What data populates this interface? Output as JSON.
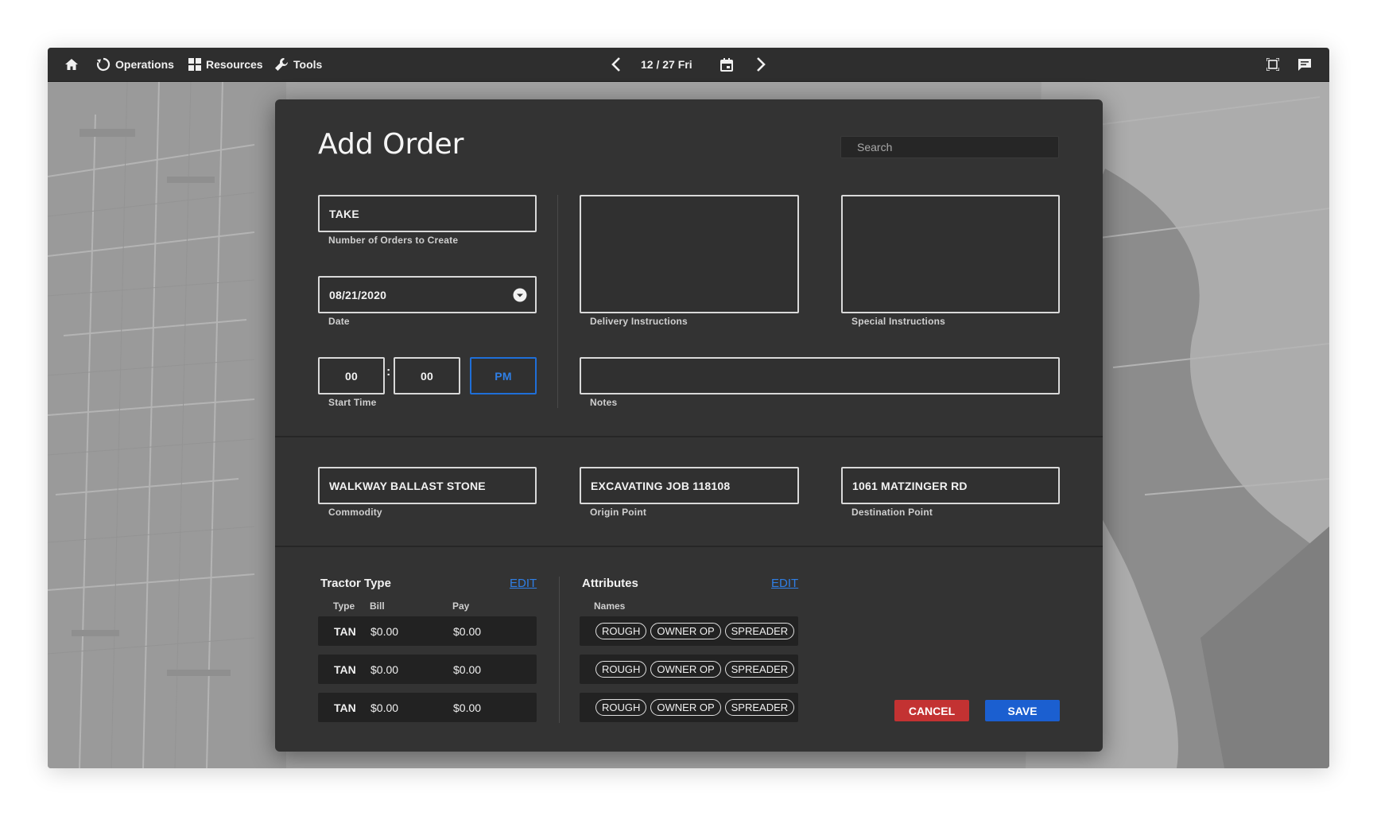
{
  "topbar": {
    "home_icon": "home-icon",
    "operations_label": "Operations",
    "resources_label": "Resources",
    "tools_label": "Tools",
    "date_display": "12 / 27 Fri"
  },
  "dialog": {
    "title": "Add Order",
    "search_placeholder": "Search",
    "orders_to_create": {
      "value": "TAKE",
      "label": "Number of Orders to Create"
    },
    "date": {
      "value": "08/21/2020",
      "label": "Date"
    },
    "start_time": {
      "hour": "00",
      "minute": "00",
      "ampm": "PM",
      "label": "Start Time"
    },
    "delivery_instructions": {
      "value": "",
      "label": "Delivery Instructions"
    },
    "special_instructions": {
      "value": "",
      "label": "Special Instructions"
    },
    "notes": {
      "value": "",
      "label": "Notes"
    },
    "commodity": {
      "value": "WALKWAY BALLAST STONE",
      "label": "Commodity"
    },
    "origin_point": {
      "value": "EXCAVATING JOB 118108",
      "label": "Origin Point"
    },
    "destination_point": {
      "value": "1061 MATZINGER RD",
      "label": "Destination Point"
    },
    "tractor_type": {
      "title": "Tractor Type",
      "edit_label": "EDIT",
      "columns": [
        "Type",
        "Bill",
        "Pay"
      ],
      "rows": [
        {
          "type": "TAN",
          "bill": "$0.00",
          "pay": "$0.00"
        },
        {
          "type": "TAN",
          "bill": "$0.00",
          "pay": "$0.00"
        },
        {
          "type": "TAN",
          "bill": "$0.00",
          "pay": "$0.00"
        }
      ]
    },
    "attributes": {
      "title": "Attributes",
      "edit_label": "EDIT",
      "column": "Names",
      "rows": [
        [
          "ROUGH",
          "OWNER OP",
          "SPREADER"
        ],
        [
          "ROUGH",
          "OWNER OP",
          "SPREADER"
        ],
        [
          "ROUGH",
          "OWNER OP",
          "SPREADER"
        ]
      ]
    },
    "cancel_label": "CANCEL",
    "save_label": "SAVE"
  },
  "colors": {
    "topbar_bg": "#2e2e2e",
    "dialog_bg": "#333333",
    "accent_blue": "#1f6fd8",
    "cancel_red": "#c33232",
    "save_blue": "#1b5fd0"
  }
}
